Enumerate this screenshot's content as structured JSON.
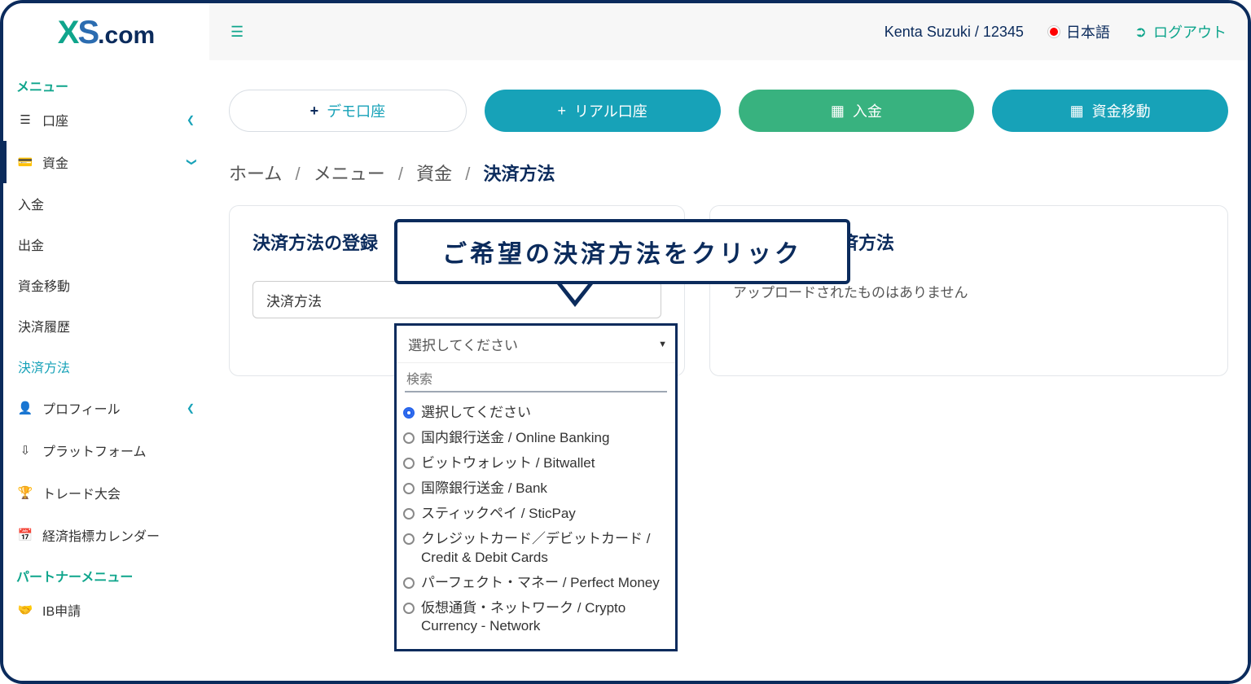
{
  "logo": {
    "x": "X",
    "s": "S",
    "dotcom": ".com"
  },
  "sidebar": {
    "menu_title": "メニュー",
    "accounts": "口座",
    "funds": "資金",
    "sub": {
      "deposit": "入金",
      "withdraw": "出金",
      "transfer": "資金移動",
      "history": "決済履歴",
      "method": "決済方法"
    },
    "profile": "プロフィール",
    "platform": "プラットフォーム",
    "contest": "トレード大会",
    "calendar": "経済指標カレンダー",
    "partner_title": "パートナーメニュー",
    "ib": "IB申請"
  },
  "header": {
    "user": "Kenta Suzuki / 12345",
    "language": "日本語",
    "logout": "ログアウト"
  },
  "pills": {
    "demo": "デモ口座",
    "real": "リアル口座",
    "deposit": "入金",
    "transfer": "資金移動"
  },
  "breadcrumb": {
    "home": "ホーム",
    "menu": "メニュー",
    "funds": "資金",
    "current": "決済方法"
  },
  "registerCard": {
    "title": "決済方法の登録",
    "field_label": "決済方法",
    "placeholder": "選択してください"
  },
  "registeredCard": {
    "title": "登録された決済方法",
    "empty": "アップロードされたものはありません"
  },
  "dropdown": {
    "search_placeholder": "検索",
    "selected": "選択してください",
    "options": {
      "0": "選択してください",
      "1": "国内銀行送金 / Online Banking",
      "2": "ビットウォレット / Bitwallet",
      "3": "国際銀行送金 / Bank",
      "4": "スティックペイ / SticPay",
      "5": "クレジットカード／デビットカード / Credit & Debit Cards",
      "6": "パーフェクト・マネー / Perfect Money",
      "7": "仮想通貨・ネットワーク / Crypto Currency - Network"
    }
  },
  "callout": "ご希望の決済方法をクリック"
}
